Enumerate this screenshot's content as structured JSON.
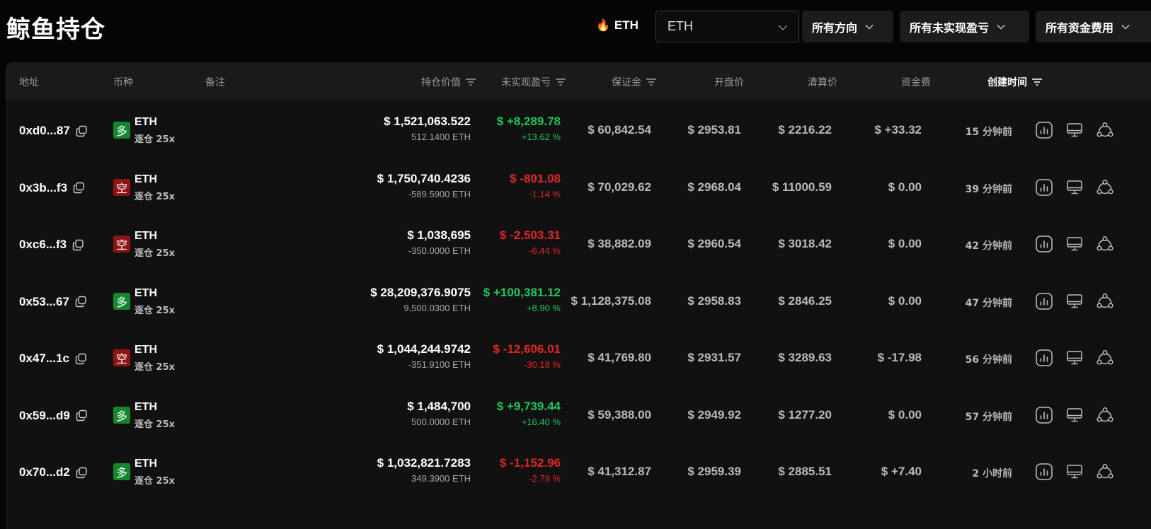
{
  "header": {
    "title": "鲸鱼持仓",
    "hot_token": "ETH",
    "token_select_value": "ETH",
    "filters": {
      "direction": "所有方向",
      "unrealized_pnl": "所有未实现盈亏",
      "funding_fee": "所有资金费用"
    }
  },
  "table": {
    "columns": {
      "address": "地址",
      "coin": "币种",
      "note": "备注",
      "position_value": "持仓价值",
      "unrealized_pnl": "未实现盈亏",
      "margin": "保证金",
      "entry_price": "开盘价",
      "liquidation_price": "清算价",
      "funding_fee": "资金费",
      "created_time": "创建时间"
    },
    "rows": [
      {
        "address": "0xd0...87",
        "side": "多",
        "side_type": "long",
        "coin": "ETH",
        "leverage": "逐仓 25x",
        "value": "$ 1,521,063.522",
        "size": "512.1400 ETH",
        "pnl": "$ +8,289.78",
        "pnl_pct": "+13.62 %",
        "pnl_color": "green",
        "margin": "$ 60,842.54",
        "entry": "$ 2953.81",
        "liq": "$ 2216.22",
        "funding": "$ +33.32",
        "funding_color": "green",
        "time": "15 分钟前"
      },
      {
        "address": "0x3b...f3",
        "side": "空",
        "side_type": "short",
        "coin": "ETH",
        "leverage": "逐仓 25x",
        "value": "$ 1,750,740.4236",
        "size": "-589.5900 ETH",
        "pnl": "$ -801.08",
        "pnl_pct": "-1.14 %",
        "pnl_color": "red",
        "margin": "$ 70,029.62",
        "entry": "$ 2968.04",
        "liq": "$ 11000.59",
        "funding": "$ 0.00",
        "funding_color": "neutral",
        "time": "39 分钟前"
      },
      {
        "address": "0xc6...f3",
        "side": "空",
        "side_type": "short",
        "coin": "ETH",
        "leverage": "逐仓 25x",
        "value": "$ 1,038,695",
        "size": "-350.0000 ETH",
        "pnl": "$ -2,503.31",
        "pnl_pct": "-6.44 %",
        "pnl_color": "red",
        "margin": "$ 38,882.09",
        "entry": "$ 2960.54",
        "liq": "$ 3018.42",
        "funding": "$ 0.00",
        "funding_color": "neutral",
        "time": "42 分钟前"
      },
      {
        "address": "0x53...67",
        "side": "多",
        "side_type": "long",
        "coin": "ETH",
        "leverage": "逐仓 25x",
        "value": "$ 28,209,376.9075",
        "size": "9,500.0300 ETH",
        "pnl": "$ +100,381.12",
        "pnl_pct": "+8.90 %",
        "pnl_color": "green",
        "margin": "$ 1,128,375.08",
        "entry": "$ 2958.83",
        "liq": "$ 2846.25",
        "funding": "$ 0.00",
        "funding_color": "neutral",
        "time": "47 分钟前"
      },
      {
        "address": "0x47...1c",
        "side": "空",
        "side_type": "short",
        "coin": "ETH",
        "leverage": "逐仓 25x",
        "value": "$ 1,044,244.9742",
        "size": "-351.9100 ETH",
        "pnl": "$ -12,606.01",
        "pnl_pct": "-30.18 %",
        "pnl_color": "red",
        "margin": "$ 41,769.80",
        "entry": "$ 2931.57",
        "liq": "$ 3289.63",
        "funding": "$ -17.98",
        "funding_color": "red",
        "time": "56 分钟前"
      },
      {
        "address": "0x59...d9",
        "side": "多",
        "side_type": "long",
        "coin": "ETH",
        "leverage": "逐仓 25x",
        "value": "$ 1,484,700",
        "size": "500.0000 ETH",
        "pnl": "$ +9,739.44",
        "pnl_pct": "+16.40 %",
        "pnl_color": "green",
        "margin": "$ 59,388.00",
        "entry": "$ 2949.92",
        "liq": "$ 1277.20",
        "funding": "$ 0.00",
        "funding_color": "neutral",
        "time": "57 分钟前"
      },
      {
        "address": "0x70...d2",
        "side": "多",
        "side_type": "long",
        "coin": "ETH",
        "leverage": "逐仓 25x",
        "value": "$ 1,032,821.7283",
        "size": "349.3900 ETH",
        "pnl": "$ -1,152.96",
        "pnl_pct": "-2.79 %",
        "pnl_color": "red",
        "margin": "$ 41,312.87",
        "entry": "$ 2959.39",
        "liq": "$ 2885.51",
        "funding": "$ +7.40",
        "funding_color": "green",
        "time": "2 小时前"
      }
    ]
  },
  "icons": {
    "hot": "fire-icon",
    "copy": "copy-icon",
    "chart": "chart-icon",
    "monitor": "monitor-icon",
    "share": "share-icon",
    "filter": "filter-icon",
    "dropdown": "chevron-down-icon"
  },
  "colors": {
    "green": "#22c55e",
    "red": "#e0262b",
    "long_badge": "#14872e",
    "short_badge": "#8f1414"
  }
}
